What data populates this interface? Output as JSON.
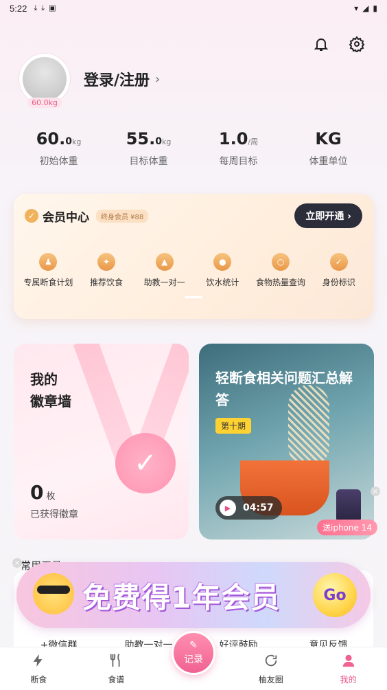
{
  "status_bar": {
    "time": "5:22"
  },
  "profile": {
    "login_label": "登录/注册",
    "weight_chip": "60.0kg"
  },
  "stats": [
    {
      "value": "60.",
      "decimal": "0",
      "unit": "kg",
      "label": "初始体重"
    },
    {
      "value": "55.",
      "decimal": "0",
      "unit": "kg",
      "label": "目标体重"
    },
    {
      "value": "1.0",
      "decimal": "",
      "unit": "/周",
      "label": "每周目标"
    },
    {
      "value": "KG",
      "decimal": "",
      "unit": "",
      "label": "体重单位"
    }
  ],
  "member": {
    "title": "会员中心",
    "tag": "终身会员 ¥88",
    "cta": "立即开通",
    "features": [
      "专属断食计划",
      "推荐饮食",
      "助教一对一",
      "饮水统计",
      "食物热量查询",
      "身份标识"
    ]
  },
  "badge_card": {
    "title_line1": "我的",
    "title_line2": "徽章墙",
    "count": "0",
    "count_unit": "枚",
    "subtitle": "已获得徽章"
  },
  "video_card": {
    "title": "轻断食相关问题汇总解答",
    "episode": "第十期",
    "duration": "04:57"
  },
  "promo": {
    "phone_label": "送iphone 14"
  },
  "tools": {
    "title": "常用工具",
    "items": [
      "+微信群",
      "助教一对一",
      "好评鼓励",
      "意见反馈"
    ]
  },
  "banner": {
    "text": "免费得1年会员",
    "go": "Go"
  },
  "tabbar": {
    "items": [
      "断食",
      "食谱",
      "记录",
      "柚友圈",
      "我的"
    ]
  },
  "colors": {
    "accent": "#e6558a",
    "gold": "#f0b25c",
    "dark": "#2b2d3a"
  }
}
